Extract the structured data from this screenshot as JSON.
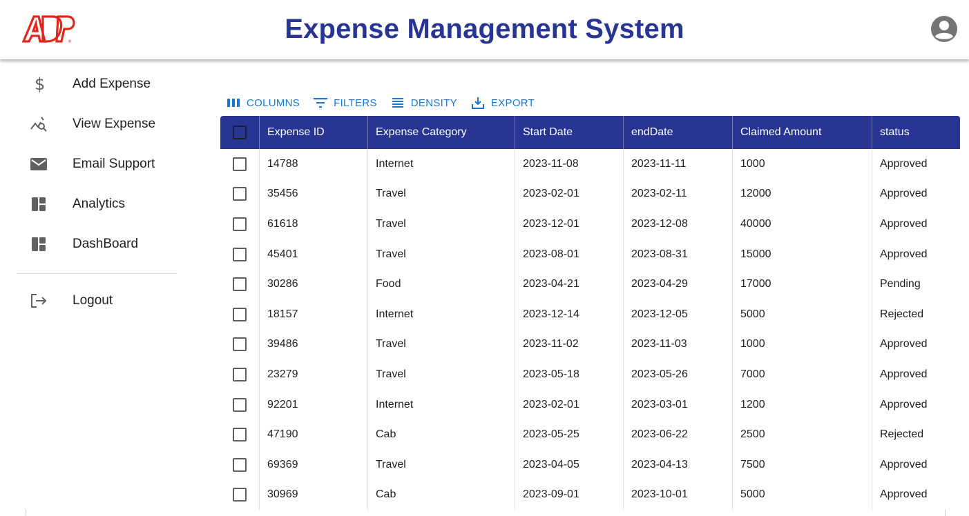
{
  "header": {
    "title": "Expense Management System",
    "brand_color": "#283593",
    "logo_color": "#e0261d"
  },
  "sidebar": {
    "items": [
      {
        "label": "Add Expense",
        "icon": "dollar-icon"
      },
      {
        "label": "View Expense",
        "icon": "query-stats-icon"
      },
      {
        "label": "Email Support",
        "icon": "mail-icon"
      },
      {
        "label": "Analytics",
        "icon": "dashboard-icon"
      },
      {
        "label": "DashBoard",
        "icon": "dashboard-icon"
      }
    ],
    "logout": {
      "label": "Logout",
      "icon": "logout-icon"
    }
  },
  "toolbar": {
    "columns": "COLUMNS",
    "filters": "FILTERS",
    "density": "DENSITY",
    "export": "EXPORT",
    "accent": "#1976d2"
  },
  "grid": {
    "headers": [
      "Expense ID",
      "Expense Category",
      "Start Date",
      "endDate",
      "Claimed Amount",
      "status"
    ],
    "rows": [
      [
        "14788",
        "Internet",
        "2023-11-08",
        "2023-11-11",
        "1000",
        "Approved"
      ],
      [
        "35456",
        "Travel",
        "2023-02-01",
        "2023-02-11",
        "12000",
        "Approved"
      ],
      [
        "61618",
        "Travel",
        "2023-12-01",
        "2023-12-08",
        "40000",
        "Approved"
      ],
      [
        "45401",
        "Travel",
        "2023-08-01",
        "2023-08-31",
        "15000",
        "Approved"
      ],
      [
        "30286",
        "Food",
        "2023-04-21",
        "2023-04-29",
        "17000",
        "Pending"
      ],
      [
        "18157",
        "Internet",
        "2023-12-14",
        "2023-12-05",
        "5000",
        "Rejected"
      ],
      [
        "39486",
        "Travel",
        "2023-11-02",
        "2023-11-03",
        "1000",
        "Approved"
      ],
      [
        "23279",
        "Travel",
        "2023-05-18",
        "2023-05-26",
        "7000",
        "Approved"
      ],
      [
        "92201",
        "Internet",
        "2023-02-01",
        "2023-03-01",
        "1200",
        "Approved"
      ],
      [
        "47190",
        "Cab",
        "2023-05-25",
        "2023-06-22",
        "2500",
        "Rejected"
      ],
      [
        "69369",
        "Travel",
        "2023-04-05",
        "2023-04-13",
        "7500",
        "Approved"
      ],
      [
        "30969",
        "Cab",
        "2023-09-01",
        "2023-10-01",
        "5000",
        "Approved"
      ]
    ]
  }
}
